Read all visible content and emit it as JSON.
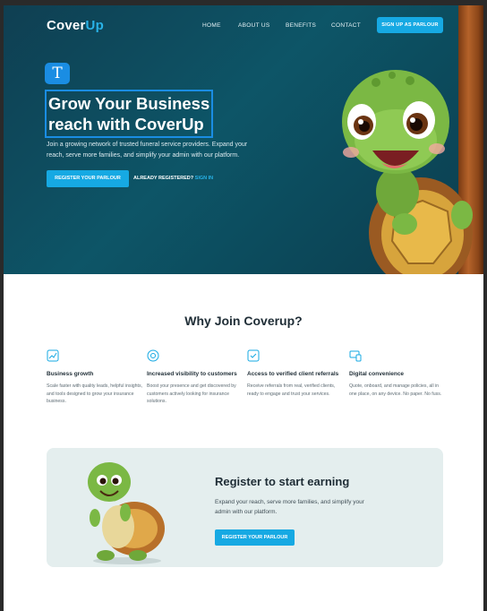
{
  "header": {
    "logo_main": "Cover",
    "logo_accent": "Up",
    "nav": [
      "HOME",
      "ABOUT US",
      "BENEFITS",
      "CONTACT"
    ],
    "signup_label": "SIGN UP AS PARLOUR"
  },
  "editor": {
    "text_tool_glyph": "T"
  },
  "hero": {
    "title_line1": "Grow Your Business",
    "title_line2": "reach with CoverUp",
    "description": "Join a growing network of trusted funeral service providers. Expand your reach, serve more families, and simplify your admin with our platform.",
    "register_label": "REGISTER YOUR PARLOUR",
    "already_label": "ALREADY REGISTERED?",
    "sign_in_label": "SIGN IN"
  },
  "why": {
    "title": "Why Join Coverup?",
    "features": [
      {
        "icon": "chart-icon",
        "title": "Business growth",
        "description": "Scale faster with quality leads, helpful insights, and tools designed to grow your insurance business."
      },
      {
        "icon": "eye-icon",
        "title": "Increased visibility to customers",
        "description": "Boost your presence and get discovered by customers actively looking for insurance solutions."
      },
      {
        "icon": "check-icon",
        "title": "Access to verified client referrals",
        "description": "Receive referrals from real, verified clients, ready to engage and trust your services."
      },
      {
        "icon": "devices-icon",
        "title": "Digital convenience",
        "description": "Quote, onboard, and manage policies, all in one place, on any device. No paper. No fuss."
      }
    ]
  },
  "cta": {
    "title": "Register to start earning",
    "description": "Expand your reach, serve more families, and simplify your admin with our platform.",
    "button_label": "REGISTER YOUR PARLOUR"
  },
  "colors": {
    "accent": "#16a9e3",
    "hero_bg": "#0d5567",
    "selection": "#1a8de3"
  }
}
